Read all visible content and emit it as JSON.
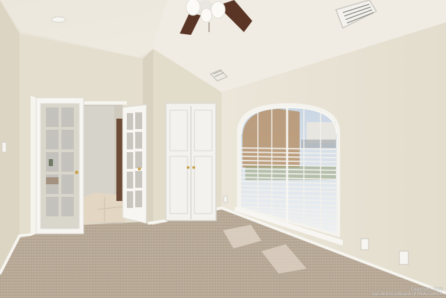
{
  "photo": {
    "subject": "empty-bedroom-interior",
    "watermark_line1": "Copyright 2025",
    "watermark_line2": "San Antonio Board of REALTORS®"
  },
  "colors": {
    "wall": "#e6e0d1",
    "ceiling": "#eee9df",
    "carpet": "#b8a896",
    "door_white": "#f4f3ef",
    "trim": "#f7f6f2",
    "fan_blade": "#5a3424"
  }
}
